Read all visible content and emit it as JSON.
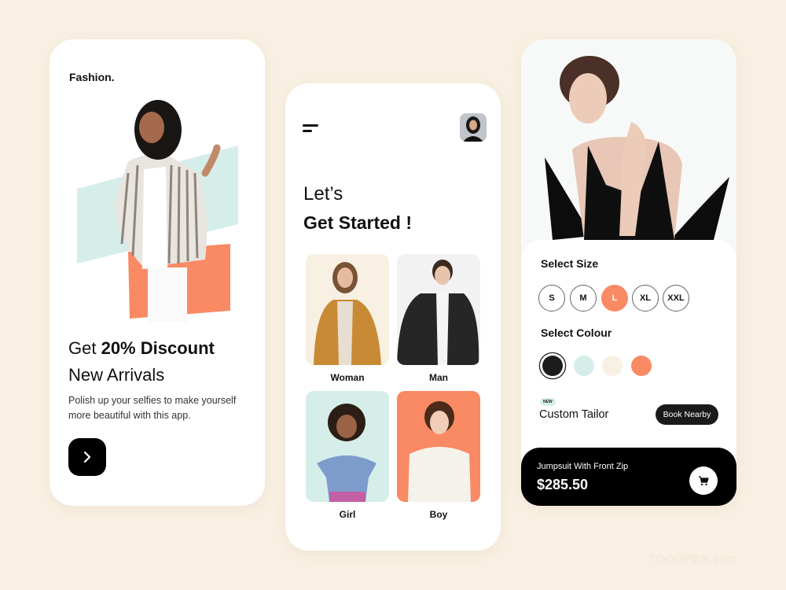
{
  "colors": {
    "background": "#f8f0e2",
    "accent_coral": "#f98a64",
    "mint": "#d6eeea",
    "cream": "#f8f0e2",
    "black": "#000000"
  },
  "screen1": {
    "brand": "Fashion.",
    "headline_prefix": "Get ",
    "headline_bold": "20% Discount",
    "headline_line2": "New Arrivals",
    "description": "Polish up your selfies to make yourself more beautiful with this  app.",
    "next_button_icon": "chevron-right-icon"
  },
  "screen2": {
    "menu_icon": "menu-icon",
    "avatar": "user-avatar",
    "greeting": "Let’s",
    "title": "Get Started !",
    "categories": [
      {
        "label": "Woman",
        "bg": "#f8f0e2"
      },
      {
        "label": "Man",
        "bg": "#f2f2f2"
      },
      {
        "label": "Girl",
        "bg": "#d6eeea"
      },
      {
        "label": "Boy",
        "bg": "#f98a64"
      }
    ]
  },
  "screen3": {
    "select_size_label": "Select Size",
    "sizes": [
      "S",
      "M",
      "L",
      "XL",
      "XXL"
    ],
    "selected_size": "L",
    "select_colour_label": "Select Colour",
    "colours": [
      "#1c1c1c",
      "#d6eeea",
      "#f8f0e2",
      "#f98a64"
    ],
    "selected_colour": "#1c1c1c",
    "badge": "NEW",
    "tailor_label": "Custom Tailor",
    "book_button": "Book Nearby",
    "product_name": "Jumpsuit With Front Zip",
    "price": "$285.50",
    "cart_icon": "cart-icon"
  },
  "watermark": "TOOOPEN.com"
}
